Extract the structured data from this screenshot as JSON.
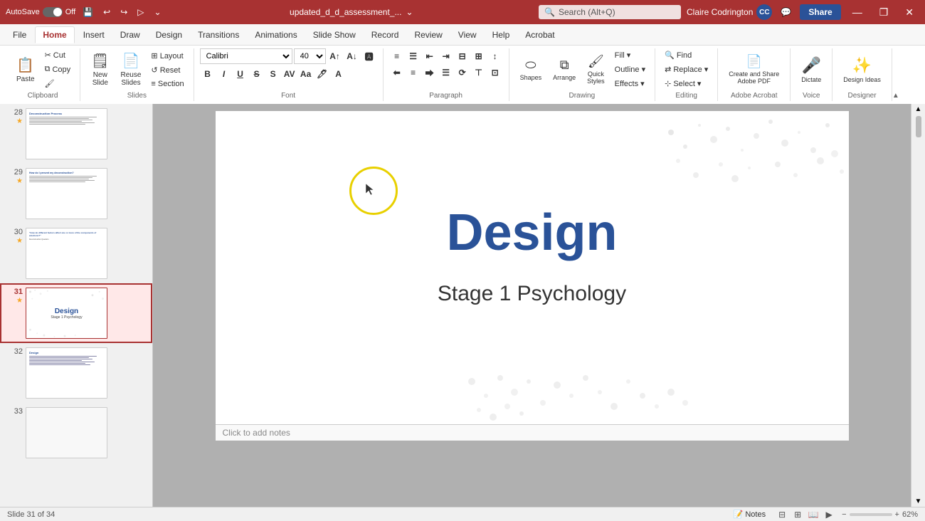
{
  "titlebar": {
    "autosave_label": "AutoSave",
    "autosave_state": "Off",
    "filename": "updated_d_d_assessment_...",
    "search_placeholder": "Search (Alt+Q)",
    "user_name": "Claire Codrington",
    "user_initials": "CC",
    "minimize": "—",
    "restore": "❐",
    "close": "✕"
  },
  "tabs": [
    {
      "label": "File",
      "active": false
    },
    {
      "label": "Home",
      "active": true
    },
    {
      "label": "Insert",
      "active": false
    },
    {
      "label": "Draw",
      "active": false
    },
    {
      "label": "Design",
      "active": false
    },
    {
      "label": "Transitions",
      "active": false
    },
    {
      "label": "Animations",
      "active": false
    },
    {
      "label": "Slide Show",
      "active": false
    },
    {
      "label": "Record",
      "active": false
    },
    {
      "label": "Review",
      "active": false
    },
    {
      "label": "View",
      "active": false
    },
    {
      "label": "Help",
      "active": false
    },
    {
      "label": "Acrobat",
      "active": false
    }
  ],
  "ribbon": {
    "groups": [
      {
        "name": "Clipboard",
        "label": "Clipboard"
      },
      {
        "name": "Slides",
        "label": "Slides"
      },
      {
        "name": "Font",
        "label": "Font"
      },
      {
        "name": "Paragraph",
        "label": "Paragraph"
      },
      {
        "name": "Drawing",
        "label": "Drawing"
      },
      {
        "name": "Editing",
        "label": "Editing"
      },
      {
        "name": "AdobeAcrobat",
        "label": "Adobe Acrobat"
      },
      {
        "name": "Voice",
        "label": "Voice"
      },
      {
        "name": "Designer",
        "label": "Designer"
      }
    ],
    "font_name": "Calibri",
    "font_size": "40",
    "select_label": "Select",
    "find_label": "Find",
    "replace_label": "Replace",
    "dictate_label": "Dictate",
    "design_ideas_label": "Design Ideas"
  },
  "slides": [
    {
      "num": 28,
      "starred": true,
      "active": false,
      "title": "Deconstruction Process"
    },
    {
      "num": 29,
      "starred": true,
      "active": false,
      "title": "How do I present my deconstruction?"
    },
    {
      "num": 30,
      "starred": true,
      "active": false,
      "title": "How do different factors affect one or more of the components of emotions?"
    },
    {
      "num": 31,
      "starred": true,
      "active": true,
      "title": "Design",
      "subtitle": "Stage 1 Psychology"
    },
    {
      "num": 32,
      "starred": false,
      "active": false,
      "title": "Design"
    },
    {
      "num": 33,
      "starred": false,
      "active": false,
      "title": ""
    }
  ],
  "canvas": {
    "title": "Design",
    "subtitle": "Stage 1 Psychology"
  },
  "notes": {
    "placeholder": "Click to add notes"
  },
  "statusbar": {
    "slide_info": "Slide 31 of 34",
    "notes_label": "Notes",
    "zoom_pct": "62%"
  },
  "share_label": "Share"
}
